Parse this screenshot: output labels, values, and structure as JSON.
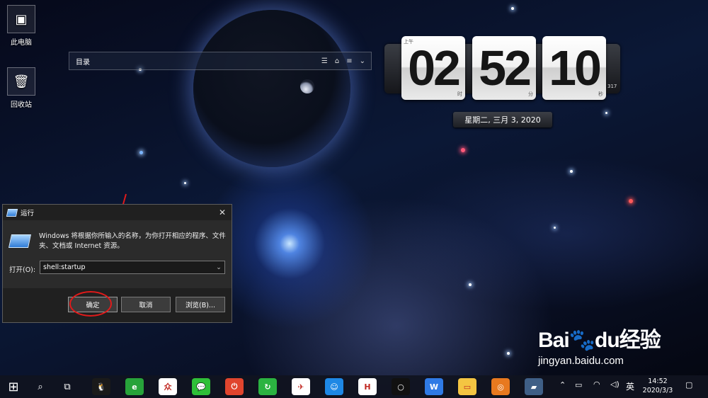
{
  "desktop": {
    "icons": [
      {
        "label": "此电脑",
        "icon": "computer-icon"
      },
      {
        "label": "回收站",
        "icon": "recycle-bin-icon"
      }
    ]
  },
  "widget": {
    "title": "目录",
    "controls": [
      "list-icon",
      "lock-icon",
      "menu-icon",
      "chevron-down-icon"
    ]
  },
  "clock": {
    "hours": "02",
    "minutes": "52",
    "seconds": "10",
    "ampm": "上午",
    "hour_unit": "时",
    "minute_unit": "分",
    "second_unit": "秒",
    "millis": "317",
    "date": "星期二, 三月 3, 2020"
  },
  "run_dialog": {
    "title": "运行",
    "description": "Windows 将根据你所输入的名称，为你打开相应的程序、文件夹、文档或 Internet 资源。",
    "open_label": "打开(O):",
    "input_value": "shell:startup",
    "ok_label": "确定",
    "cancel_label": "取消",
    "browse_label": "浏览(B)..."
  },
  "taskbar": {
    "apps": [
      {
        "name": "qq",
        "glyph": "🐧",
        "color": "#1a1a1a"
      },
      {
        "name": "browser",
        "glyph": "e",
        "color": "#27a33a"
      },
      {
        "name": "wps-pdf",
        "glyph": "众",
        "color": "#ffffff"
      },
      {
        "name": "wechat",
        "glyph": "💬",
        "color": "#2fbf38"
      },
      {
        "name": "power-app",
        "glyph": "⏻",
        "color": "#e0452e"
      },
      {
        "name": "refresh-app",
        "glyph": "↻",
        "color": "#2bb341"
      },
      {
        "name": "feishu",
        "glyph": "✈",
        "color": "#ffffff"
      },
      {
        "name": "tim",
        "glyph": "☺",
        "color": "#1e88e5"
      },
      {
        "name": "h-app",
        "glyph": "H",
        "color": "#ffffff"
      },
      {
        "name": "circle-app",
        "glyph": "○",
        "color": "#111111"
      },
      {
        "name": "wps",
        "glyph": "W",
        "color": "#2f7ae5"
      },
      {
        "name": "file-explorer",
        "glyph": "▭",
        "color": "#f4c542"
      },
      {
        "name": "baidu-app",
        "glyph": "◎",
        "color": "#e8791f"
      },
      {
        "name": "run-app",
        "glyph": "▰",
        "color": "#3f5f86"
      }
    ],
    "ime": "英",
    "time": "14:52",
    "date": "2020/3/3"
  },
  "watermark": {
    "brand": "Bai",
    "brand2": "du",
    "cn": "经验",
    "url": "jingyan.baidu.com"
  },
  "colors": {
    "annotation": "#e01a1a",
    "taskbar": "#10141f"
  }
}
